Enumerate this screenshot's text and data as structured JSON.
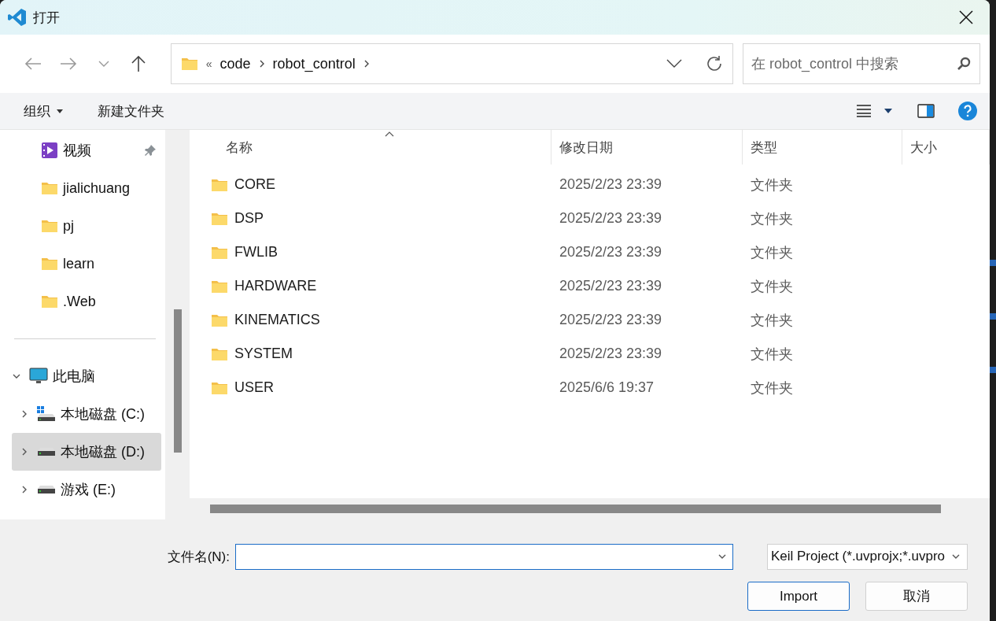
{
  "window": {
    "title": "打开"
  },
  "nav": {
    "overflow": "«",
    "path": [
      "code",
      "robot_control"
    ],
    "search_placeholder": "在 robot_control 中搜索"
  },
  "toolbar": {
    "organize": "组织",
    "new_folder": "新建文件夹"
  },
  "sidebar": {
    "items": [
      {
        "label": "视频",
        "kind": "video",
        "pinned": true
      },
      {
        "label": "jialichuang",
        "kind": "folder",
        "pinned": false
      },
      {
        "label": "pj",
        "kind": "folder",
        "pinned": false
      },
      {
        "label": "learn",
        "kind": "folder",
        "pinned": false
      },
      {
        "label": ".Web",
        "kind": "folder",
        "pinned": false
      }
    ],
    "tree": [
      {
        "label": "此电脑",
        "kind": "pc",
        "expanded": true,
        "selected": false,
        "children": [
          {
            "label": "本地磁盘 (C:)",
            "kind": "system",
            "expanded": false,
            "selected": false
          },
          {
            "label": "本地磁盘 (D:)",
            "kind": "drive",
            "expanded": false,
            "selected": true
          },
          {
            "label": "游戏 (E:)",
            "kind": "drive",
            "expanded": false,
            "selected": false
          }
        ]
      }
    ]
  },
  "table": {
    "columns": [
      {
        "label": "名称",
        "sorted": true
      },
      {
        "label": "修改日期",
        "sorted": false
      },
      {
        "label": "类型",
        "sorted": false
      },
      {
        "label": "大小",
        "sorted": false
      }
    ],
    "rows": [
      {
        "name": "CORE",
        "date": "2025/2/23 23:39",
        "type": "文件夹"
      },
      {
        "name": "DSP",
        "date": "2025/2/23 23:39",
        "type": "文件夹"
      },
      {
        "name": "FWLIB",
        "date": "2025/2/23 23:39",
        "type": "文件夹"
      },
      {
        "name": "HARDWARE",
        "date": "2025/2/23 23:39",
        "type": "文件夹"
      },
      {
        "name": "KINEMATICS",
        "date": "2025/2/23 23:39",
        "type": "文件夹"
      },
      {
        "name": "SYSTEM",
        "date": "2025/2/23 23:39",
        "type": "文件夹"
      },
      {
        "name": "USER",
        "date": "2025/6/6 19:37",
        "type": "文件夹"
      }
    ]
  },
  "footer": {
    "filename_label": "文件名(N):",
    "filter": "Keil Project (*.uvprojx;*.uvpro",
    "buttons": [
      {
        "label": "Import",
        "kind": "primary"
      },
      {
        "label": "取消",
        "kind": "secondary"
      }
    ]
  }
}
